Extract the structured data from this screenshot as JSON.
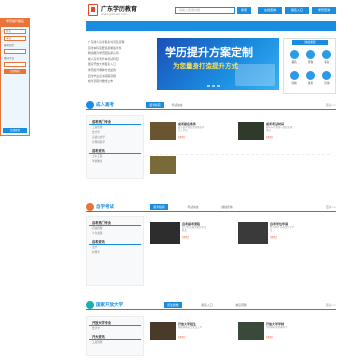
{
  "header": {
    "logo_text": "广东学历教育",
    "logo_sub": "www.gdxueli.com",
    "search_placeholder": "请输入搜索内容",
    "search_btn": "搜索",
    "buttons": [
      "在线咨询",
      "报名入口",
      "学历查询"
    ]
  },
  "sidebar": {
    "title": "学历提升报名",
    "name_placeholder": "姓名",
    "phone_placeholder": "电话",
    "level_label": "报考层次",
    "major_label": "意向专业",
    "submit": "立即报名",
    "footer": "在线咨询"
  },
  "news": [
    "广东成人高考报名时间及流程",
    "自考本科需要满足哪些条件",
    "网络教育学历国家承认吗",
    "成人高考专升本考试科目",
    "国家开放大学报名入口",
    "学历提升哪种方式最快",
    "自考毕业证书领取流程",
    "成考录取分数线公布"
  ],
  "banner": {
    "title": "学历提升方案定制",
    "subtitle": "为您量身打造提升方式"
  },
  "quick": {
    "title": "快速通道",
    "items": [
      "报名",
      "查询",
      "专业",
      "院校",
      "资讯",
      "咨询"
    ]
  },
  "sections": [
    {
      "title": "成人高考",
      "tabs": [
        "报考指南",
        "考试动态"
      ],
      "more": "更多>>",
      "left_head": "成考热门专业",
      "left_items": [
        "工商管理",
        "会计学",
        "汉语言文学",
        "计算机科学",
        "土木工程",
        "学前教育"
      ],
      "left_head2": "成考资讯"
    },
    {
      "title": "自学考试",
      "tabs": [
        "报考指南",
        "考试动态",
        "成绩查询"
      ],
      "more": "更多>>",
      "left_head": "自考热门专业",
      "left_items": [
        "行政管理",
        "人力资源",
        "法学",
        "护理学"
      ],
      "left_head2": "自考资讯"
    },
    {
      "title": "国家开放大学",
      "tabs": [
        "招生简章",
        "报名入口",
        "常见问题"
      ],
      "more": "更多>>",
      "left_head": "开放大学专业",
      "left_items": [
        "会计学",
        "工商管理"
      ],
      "left_head2": "开大资讯"
    }
  ],
  "cards": [
    {
      "title": "成考报名条件",
      "desc": "成人高考报名需具备高中以上学历",
      "link": "[详情]"
    },
    {
      "title": "成考考试时间",
      "desc": "每年十月份统一组织全国考试",
      "link": "[详情]"
    },
    {
      "title": "自考报考流程",
      "desc": "自学考试每年两次考试机会",
      "link": "[详情]"
    },
    {
      "title": "自考学位申请",
      "desc": "符合条件可申请学士学位",
      "link": "[详情]"
    },
    {
      "title": "开放大学招生",
      "desc": "春秋两季招生免试入学",
      "link": "[详情]"
    },
    {
      "title": "开放大学学制",
      "desc": "专科本科学制两年半",
      "link": "[详情]"
    }
  ],
  "colors": {
    "brand": "#1b8de0",
    "accent": "#e8743a",
    "link": "#e04b2a"
  }
}
